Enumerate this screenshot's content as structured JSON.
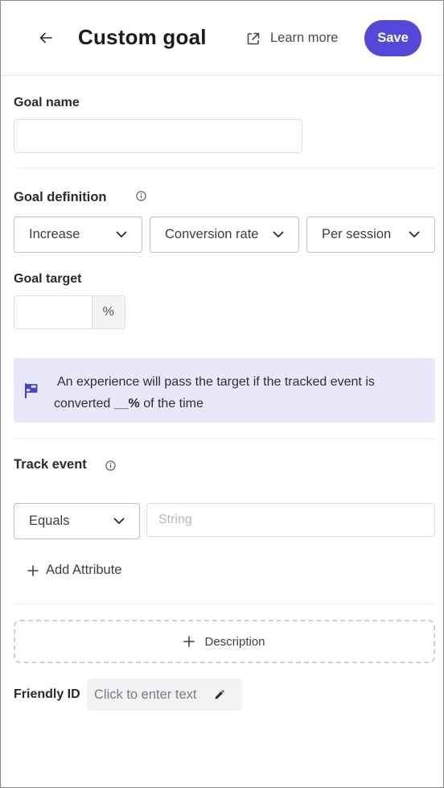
{
  "header": {
    "title": "Custom goal",
    "learn_more": "Learn more",
    "save": "Save"
  },
  "goal_name": {
    "label": "Goal name",
    "value": ""
  },
  "goal_definition": {
    "label": "Goal definition",
    "direction": "Increase",
    "metric": "Conversion rate",
    "scope": "Per session"
  },
  "goal_target": {
    "label": "Goal target",
    "value": "",
    "unit": "%"
  },
  "info_box": {
    "line1": "An experience will pass the target if the tracked event is",
    "line2_pre": "converted ",
    "line2_bold": "__%",
    "line2_post": " of the time"
  },
  "track_event": {
    "label": "Track event",
    "operator": "Equals",
    "value_placeholder": "String",
    "add_attribute": "Add Attribute"
  },
  "description": {
    "label": "Description"
  },
  "friendly_id": {
    "label": "Friendly ID",
    "placeholder": "Click to enter text"
  },
  "colors": {
    "primary": "#5548d9",
    "info_bg": "#e8e8fa"
  },
  "icons": [
    "arrow-left-icon",
    "external-link-icon",
    "info-icon",
    "chevron-down-icon",
    "flag-icon",
    "plus-icon",
    "pencil-icon"
  ]
}
